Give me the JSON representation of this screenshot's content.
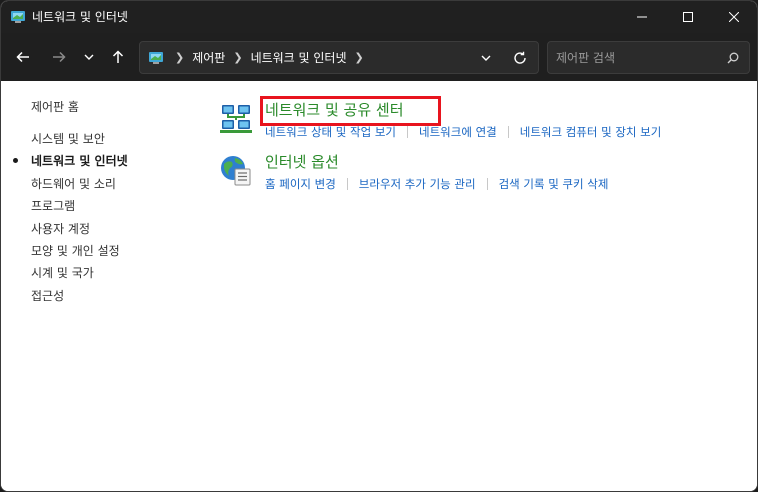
{
  "window": {
    "title": "네트워크 및 인터넷"
  },
  "nav": {
    "breadcrumbs": [
      "제어판",
      "네트워크 및 인터넷"
    ],
    "search_placeholder": "제어판 검색"
  },
  "sidebar": {
    "home": "제어판 홈",
    "items": [
      {
        "label": "시스템 및 보안",
        "active": false
      },
      {
        "label": "네트워크 및 인터넷",
        "active": true
      },
      {
        "label": "하드웨어 및 소리",
        "active": false
      },
      {
        "label": "프로그램",
        "active": false
      },
      {
        "label": "사용자 계정",
        "active": false
      },
      {
        "label": "모양 및 개인 설정",
        "active": false
      },
      {
        "label": "시계 및 국가",
        "active": false
      },
      {
        "label": "접근성",
        "active": false
      }
    ]
  },
  "categories": {
    "network": {
      "title": "네트워크 및 공유 센터",
      "links": [
        "네트워크 상태 및 작업 보기",
        "네트워크에 연결",
        "네트워크 컴퓨터 및 장치 보기"
      ]
    },
    "internet": {
      "title": "인터넷 옵션",
      "links": [
        "홈 페이지 변경",
        "브라우저 추가 기능 관리",
        "검색 기록 및 쿠키 삭제"
      ]
    }
  },
  "colors": {
    "category_title": "#2a8a2a",
    "link": "#1a66c2",
    "highlight": "#e8141e"
  }
}
